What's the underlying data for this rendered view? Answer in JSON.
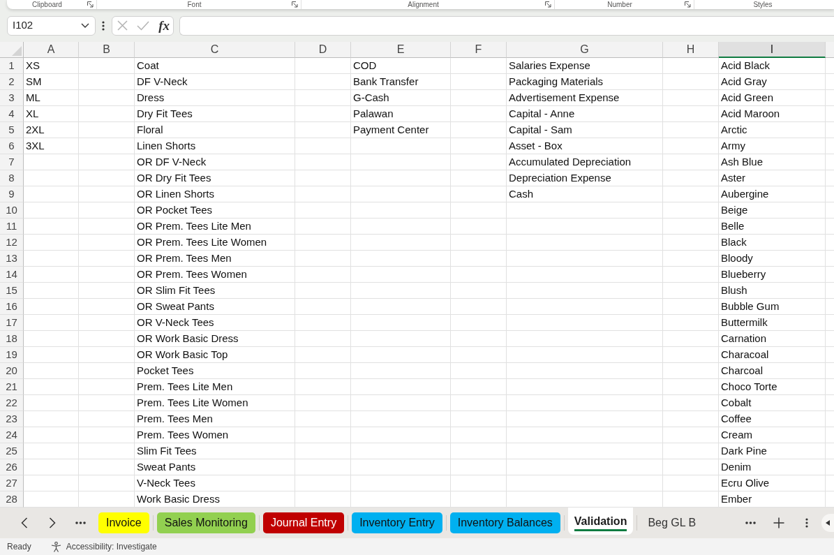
{
  "ribbon": {
    "groups": [
      {
        "label": "Clipboard",
        "launcher": true
      },
      {
        "label": "Font",
        "launcher": true
      },
      {
        "label": "Alignment",
        "launcher": true
      },
      {
        "label": "Number",
        "launcher": true
      },
      {
        "label": "Styles",
        "launcher": false
      }
    ]
  },
  "formula_bar": {
    "name_box": "I102",
    "edit_buttons_disabled": true,
    "function_button": "fx"
  },
  "sheet": {
    "columns": [
      {
        "label": "A",
        "selected": false,
        "cells": [
          "XS",
          "SM",
          "ML",
          "XL",
          "2XL",
          "3XL"
        ]
      },
      {
        "label": "B",
        "selected": false
      },
      {
        "label": "C",
        "selected": false,
        "cells": [
          "Coat",
          "DF V-Neck",
          "Dress",
          "Dry Fit Tees",
          "Floral",
          "Linen Shorts",
          "OR DF V-Neck",
          "OR Dry Fit Tees",
          "OR Linen Shorts",
          "OR Pocket Tees",
          "OR Prem. Tees Lite Men",
          "OR Prem. Tees Lite Women",
          "OR Prem. Tees Men",
          "OR Prem. Tees Women",
          "OR Slim Fit Tees",
          "OR Sweat Pants",
          "OR V-Neck Tees",
          "OR Work Basic Dress",
          "OR Work Basic Top",
          "Pocket Tees",
          "Prem. Tees Lite Men",
          "Prem. Tees Lite Women",
          "Prem. Tees Men",
          "Prem. Tees Women",
          "Slim Fit Tees",
          "Sweat Pants",
          "V-Neck Tees",
          "Work Basic Dress"
        ]
      },
      {
        "label": "D",
        "selected": false
      },
      {
        "label": "E",
        "selected": false,
        "cells": [
          "COD",
          "Bank Transfer",
          "G-Cash",
          "Palawan",
          "Payment Center"
        ]
      },
      {
        "label": "F",
        "selected": false
      },
      {
        "label": "G",
        "selected": false,
        "cells": [
          "Salaries Expense",
          "Packaging Materials",
          "Advertisement Expense",
          "Capital - Anne",
          "Capital - Sam",
          "Asset - Box",
          "Accumulated Depreciation",
          "Depreciation Expense",
          "Cash"
        ]
      },
      {
        "label": "H",
        "selected": false
      },
      {
        "label": "I",
        "selected": true,
        "cells": [
          "Acid Black",
          "Acid Gray",
          "Acid Green",
          "Acid Maroon",
          "Arctic",
          "Army",
          "Ash Blue",
          "Aster",
          "Aubergine",
          "Beige",
          "Belle",
          "Black",
          "Bloody",
          "Blueberry",
          "Blush",
          "Bubble Gum",
          "Buttermilk",
          "Carnation",
          "Characoal",
          "Charcoal",
          "Choco Torte",
          "Cobalt",
          "Coffee",
          "Cream",
          "Dark Pine",
          "Denim",
          "Ecru Olive",
          "Ember"
        ]
      }
    ],
    "row_headers": [
      "1",
      "2",
      "3",
      "4",
      "5",
      "6",
      "7",
      "8",
      "9",
      "10",
      "11",
      "12",
      "13",
      "14",
      "15",
      "16",
      "17",
      "18",
      "19",
      "20",
      "21",
      "22",
      "23",
      "24",
      "25",
      "26",
      "27",
      "28"
    ]
  },
  "sheet_tabs": [
    {
      "label": "Invoice",
      "color": "#ffff00",
      "selected": false
    },
    {
      "label": "Sales Monitoring",
      "color": "#92d050",
      "selected": false
    },
    {
      "label": "Journal Entry",
      "color": "#c00000",
      "selected": false
    },
    {
      "label": "Inventory Entry",
      "color": "#00b0f0",
      "selected": false
    },
    {
      "label": "Inventory Balances",
      "color": "#00b0f0",
      "selected": false
    },
    {
      "label": "Validation",
      "selected": true
    },
    {
      "label": "Beg GL B",
      "selected": false
    }
  ],
  "status_bar": {
    "status": "Ready",
    "accessibility": "Accessibility: Investigate"
  }
}
